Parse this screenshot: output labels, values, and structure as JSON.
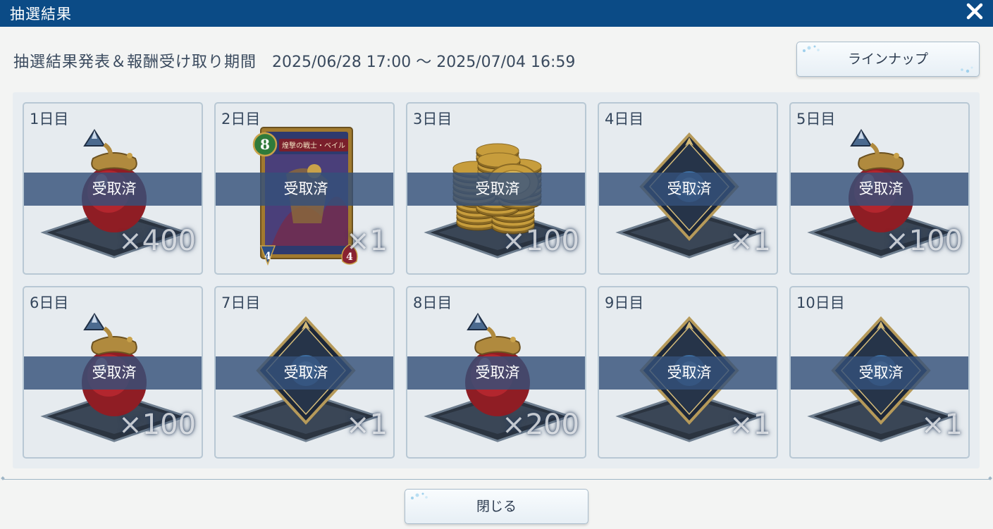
{
  "header": {
    "title": "抽選結果"
  },
  "period": {
    "label": "抽選結果発表＆報酬受け取り期間",
    "dates": "2025/06/28 17:00 ～ 2025/07/04 16:59"
  },
  "buttons": {
    "lineup": "ラインナップ",
    "close": "閉じる"
  },
  "days": [
    {
      "day": "1日目",
      "item": "potion-icon",
      "status": "受取済",
      "qty": "×400"
    },
    {
      "day": "2日目",
      "item": "card-icon",
      "status": "受取済",
      "qty": "×1",
      "card": {
        "cost": "8",
        "name": "煌撃の戦士・ベイル",
        "attack": "4",
        "defense": "4"
      }
    },
    {
      "day": "3日目",
      "item": "coins-icon",
      "status": "受取済",
      "qty": "×100"
    },
    {
      "day": "4日目",
      "item": "crest-icon",
      "status": "受取済",
      "qty": "×1"
    },
    {
      "day": "5日目",
      "item": "potion-icon",
      "status": "受取済",
      "qty": "×100"
    },
    {
      "day": "6日目",
      "item": "potion-icon",
      "status": "受取済",
      "qty": "×100"
    },
    {
      "day": "7日目",
      "item": "crest-icon",
      "status": "受取済",
      "qty": "×1"
    },
    {
      "day": "8日目",
      "item": "potion-icon",
      "status": "受取済",
      "qty": "×200"
    },
    {
      "day": "9日目",
      "item": "crest-icon",
      "status": "受取済",
      "qty": "×1"
    },
    {
      "day": "10日目",
      "item": "crest-icon",
      "status": "受取済",
      "qty": "×1"
    }
  ]
}
